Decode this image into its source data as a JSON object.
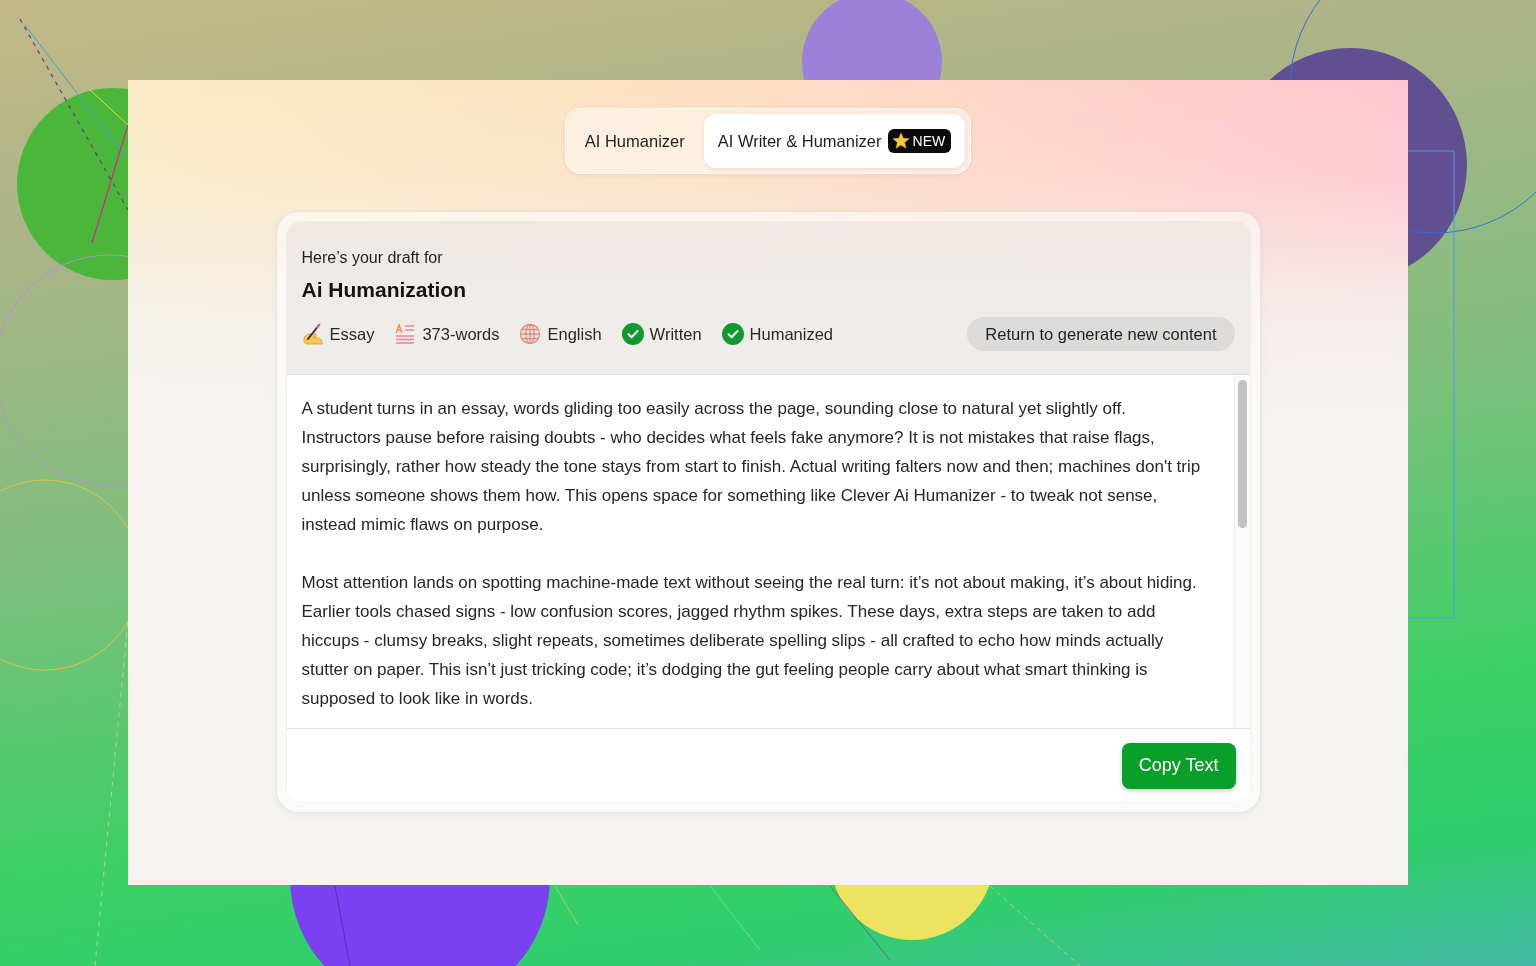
{
  "tabs": [
    {
      "label": "AI Humanizer",
      "selected": false
    },
    {
      "label": "AI Writer & Humanizer",
      "selected": true,
      "badge": "NEW"
    }
  ],
  "draft": {
    "intro": "Here’s your draft for",
    "title": "Ai Humanization",
    "meta": [
      {
        "kind": "essay",
        "label": "Essay"
      },
      {
        "kind": "word-count",
        "label": "373-words"
      },
      {
        "kind": "language",
        "label": "English"
      },
      {
        "kind": "status",
        "label": "Written",
        "done": true
      },
      {
        "kind": "status",
        "label": "Humanized",
        "done": true
      }
    ],
    "return_button": "Return to generate new content",
    "paragraphs": [
      "A student turns in an essay, words gliding too easily across the page, sounding close to natural yet slightly off. Instructors pause before raising doubts - who decides what feels fake anymore? It is not mistakes that raise flags, surprisingly, rather how steady the tone stays from start to finish. Actual writing falters now and then; machines don't trip unless someone shows them how. This opens space for something like Clever Ai Humanizer - to tweak not sense, instead mimic flaws on purpose.",
      "Most attention lands on spotting machine-made text without seeing the real turn: it’s not about making, it’s about hiding. Earlier tools chased signs - low confusion scores, jagged rhythm spikes. These days, extra steps are taken to add hiccups - clumsy breaks, slight repeats, sometimes deliberate spelling slips - all crafted to echo how minds actually stutter on paper. This isn’t just tricking code; it’s dodging the gut feeling people carry about what smart thinking is supposed to look like in words."
    ],
    "copy_button": "Copy Text"
  }
}
